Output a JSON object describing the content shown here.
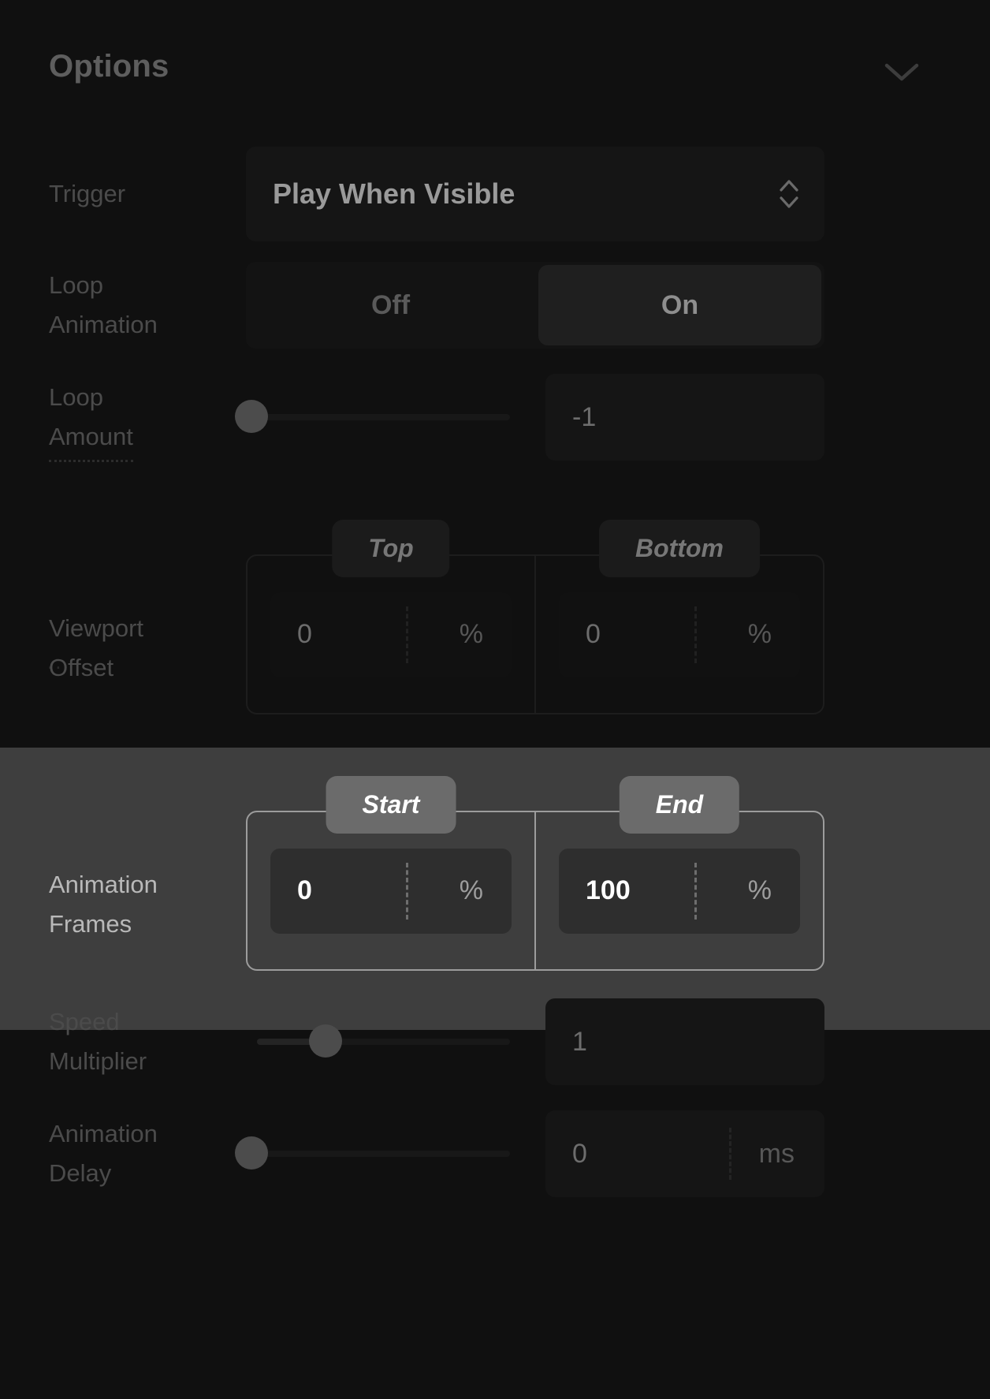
{
  "header": {
    "title": "Options",
    "collapse_icon": "chevron-down-icon"
  },
  "rows": {
    "trigger": {
      "label": "Trigger",
      "value": "Play When Visible",
      "arrows_icon": "chevron-up-down-icon"
    },
    "loop_animation": {
      "label_line1": "Loop",
      "label_line2": "Animation",
      "options": [
        "Off",
        "On"
      ],
      "selected": "On"
    },
    "loop_amount": {
      "label_line1": "Loop",
      "label_line2": "Amount",
      "value": "-1",
      "slider_percent": 2
    },
    "viewport_offset": {
      "label_line1": "Viewport",
      "label_line2": "Offset",
      "marker": "..",
      "columns": [
        {
          "chip": "Top",
          "value": "0",
          "unit": "%"
        },
        {
          "chip": "Bottom",
          "value": "0",
          "unit": "%"
        }
      ]
    },
    "animation_frames": {
      "label_line1": "Animation",
      "label_line2": "Frames",
      "highlighted": true,
      "columns": [
        {
          "chip": "Start",
          "value": "0",
          "unit": "%"
        },
        {
          "chip": "End",
          "value": "100",
          "unit": "%"
        }
      ]
    },
    "speed_multiplier": {
      "label_line1": "Speed",
      "label_line2": "Multiplier",
      "value": "1",
      "slider_percent": 27
    },
    "animation_delay": {
      "label_line1": "Animation",
      "label_line2": "Delay",
      "value": "0",
      "unit": "ms",
      "slider_percent": 2
    }
  },
  "colors": {
    "panel_background": "#101010",
    "highlight_band": "#3e3e3e",
    "label_text": "#4b4b4b",
    "value_text": "#6d6d6d",
    "highlight_text": "#ffffff",
    "chip_active": "#6b6b6b"
  }
}
